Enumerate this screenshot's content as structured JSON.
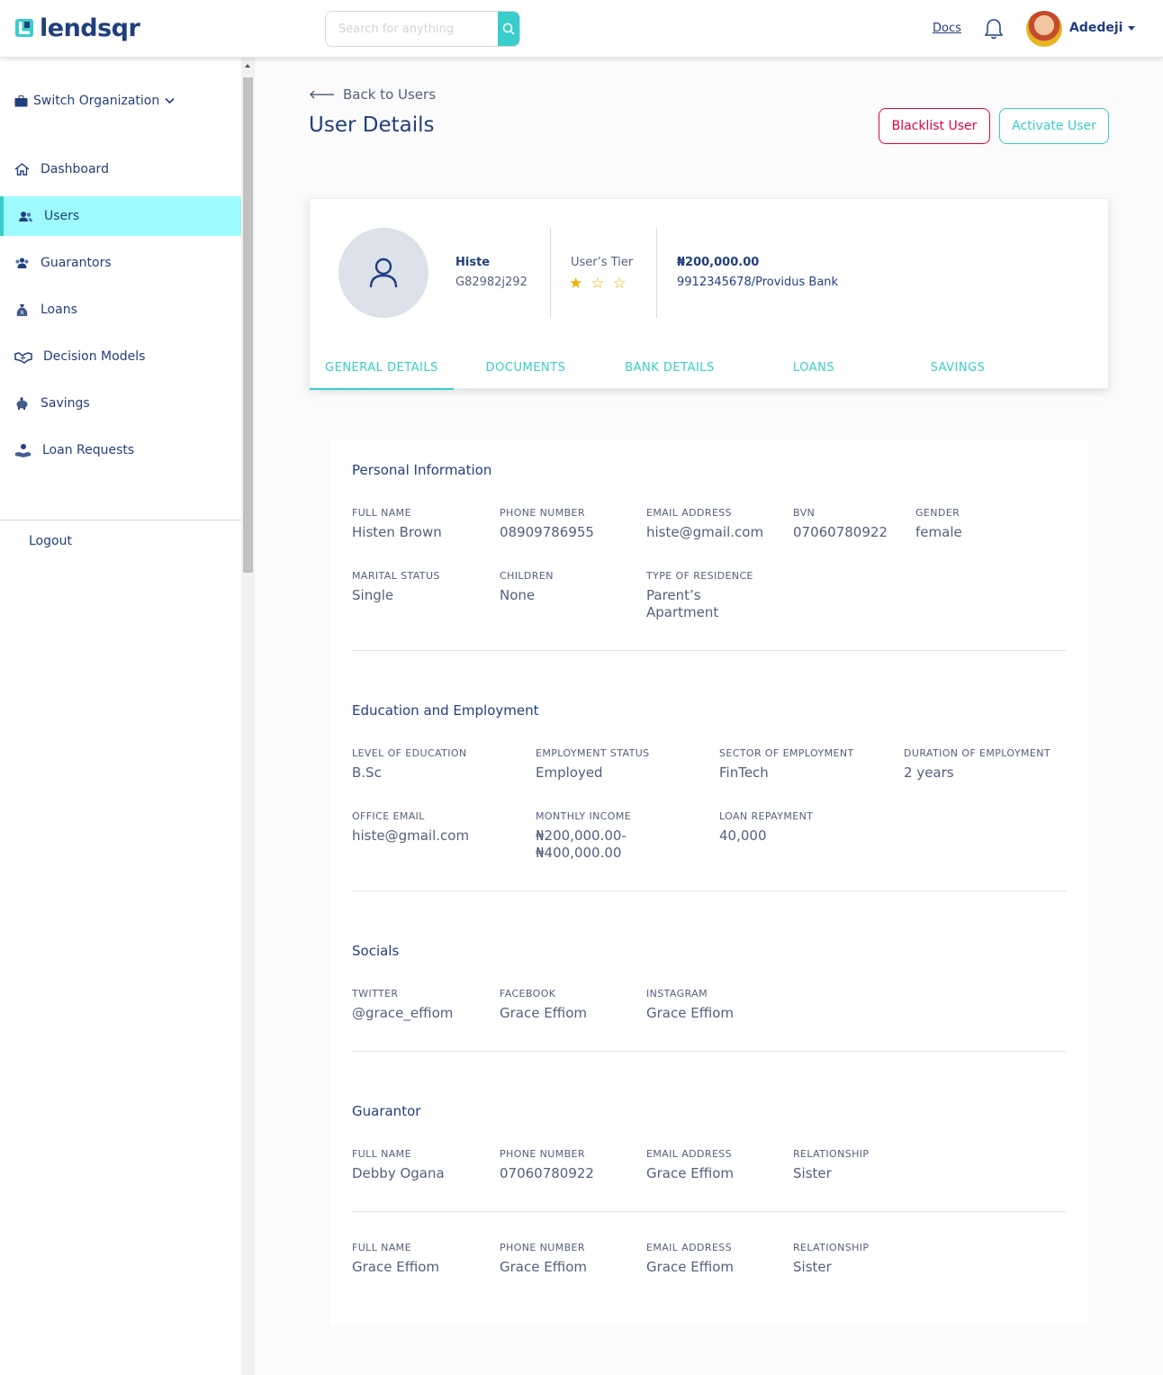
{
  "header": {
    "logo_text": "lendsqr",
    "search_placeholder": "Search for anything",
    "docs_label": "Docs",
    "username": "Adedeji"
  },
  "sidebar": {
    "switch_org": "Switch Organization",
    "items": [
      {
        "label": "Dashboard",
        "icon": "home-icon"
      },
      {
        "label": "Users",
        "icon": "users-icon",
        "active": true
      },
      {
        "label": "Guarantors",
        "icon": "guarantors-icon"
      },
      {
        "label": "Loans",
        "icon": "loan-sack-icon"
      },
      {
        "label": "Decision Models",
        "icon": "handshake-icon"
      },
      {
        "label": "Savings",
        "icon": "piggy-bank-icon"
      },
      {
        "label": "Loan Requests",
        "icon": "hand-coin-icon"
      }
    ],
    "logout": "Logout"
  },
  "main": {
    "back_label": "Back to Users",
    "title": "User Details",
    "blacklist_label": "Blacklist User",
    "activate_label": "Activate User",
    "profile": {
      "name": "Histe",
      "user_id": "G82982j292",
      "tier_label": "User’s Tier",
      "tier_stars": "★☆☆",
      "balance": "₦200,000.00",
      "bank": "9912345678/Providus Bank"
    },
    "tabs": [
      "GENERAL DETAILS",
      "DOCUMENTS",
      "BANK DETAILS",
      "LOANS",
      "SAVINGS"
    ],
    "personal": {
      "title": "Personal Information",
      "full_name_label": "FULL NAME",
      "full_name": "Histen Brown",
      "phone_label": "PHONE NUMBER",
      "phone": "08909786955",
      "email_label": "EMAIL ADDRESS",
      "email": "histe@gmail.com",
      "bvn_label": "BVN",
      "bvn": "07060780922",
      "gender_label": "GENDER",
      "gender": "female",
      "marital_label": "MARITAL STATUS",
      "marital": "Single",
      "children_label": "CHILDREN",
      "children": "None",
      "residence_label": "TYPE OF RESIDENCE",
      "residence": "Parent’s Apartment"
    },
    "education": {
      "title": "Education and Employment",
      "level_label": "LEVEL OF EDUCATION",
      "level": "B.Sc",
      "status_label": "EMPLOYMENT STATUS",
      "status": "Employed",
      "sector_label": "SECTOR OF EMPLOYMENT",
      "sector": "FinTech",
      "duration_label": "DURATION OF EMPLOYMENT",
      "duration": "2 years",
      "office_email_label": "OFFICE EMAIL",
      "office_email": "histe@gmail.com",
      "income_label": "MONTHLY INCOME",
      "income": "₦200,000.00- ₦400,000.00",
      "repayment_label": "LOAN REPAYMENT",
      "repayment": "40,000"
    },
    "socials": {
      "title": "Socials",
      "twitter_label": "TWITTER",
      "twitter": "@grace_effiom",
      "facebook_label": "FACEBOOK",
      "facebook": "Grace Effiom",
      "instagram_label": "INSTAGRAM",
      "instagram": "Grace Effiom"
    },
    "guarantor": {
      "title": "Guarantor",
      "g1": {
        "name_label": "FULL NAME",
        "name": "Debby Ogana",
        "phone_label": "PHONE NUMBER",
        "phone": "07060780922",
        "email_label": "EMAIL ADDRESS",
        "email": "Grace Effiom",
        "rel_label": "RELATIONSHIP",
        "rel": "Sister"
      },
      "g2": {
        "name_label": "FULL NAME",
        "name": "Grace Effiom",
        "phone_label": "PHONE NUMBER",
        "phone": "Grace Effiom",
        "email_label": "EMAIL ADDRESS",
        "email": "Grace Effiom",
        "rel_label": "RELATIONSHIP",
        "rel": "Sister"
      }
    }
  },
  "colors": {
    "primary": "#213F7D",
    "accent": "#39CDCC",
    "danger": "#E4033B",
    "star": "#E9B200",
    "active_nav": "#9DFBFB"
  }
}
